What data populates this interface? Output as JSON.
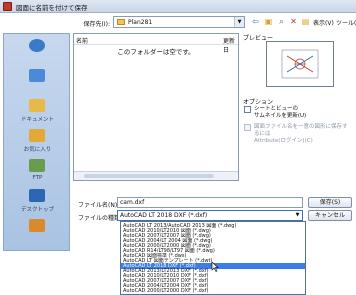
{
  "window": {
    "title": "図面に名前を付けて保存"
  },
  "toolbar": {
    "save_in_label": "保存先(I):",
    "save_in_value": "Plan281",
    "view_label": "表示(V)",
    "tools_label": "ツール(L)"
  },
  "places": [
    {
      "label": "",
      "icon": "history-icon",
      "color": "#3a7bc8"
    },
    {
      "label": "",
      "icon": "network-icon",
      "color": "#4a8ad8"
    },
    {
      "label": "ドキュメント",
      "icon": "documents-icon",
      "color": "#e8b84a"
    },
    {
      "label": "お気に入り",
      "icon": "favorites-icon",
      "color": "#e3a936"
    },
    {
      "label": "FTP",
      "icon": "ftp-icon",
      "color": "#6a9c4e"
    },
    {
      "label": "デスクトップ",
      "icon": "desktop-icon",
      "color": "#2f66b3"
    },
    {
      "label": "",
      "icon": "buzzsaw-icon",
      "color": "#d98b2b"
    }
  ],
  "file_list": {
    "col_name": "名前",
    "col_date": "更新日",
    "empty_message": "このフォルダーは空です。"
  },
  "preview": {
    "label": "プレビュー"
  },
  "options": {
    "label": "オプション",
    "check1": "シートとビューの\nサムネイルを更新(U)",
    "check2": "図面ファイル名を一意の図形に保存するには\nAttribute(ログイン)(C)"
  },
  "form": {
    "filename_label": "ファイル名(N):",
    "filename_value": "cam.dxf",
    "filetype_label": "ファイルの種類(T):",
    "filetype_value": "AutoCAD LT 2018 DXF (*.dxf)"
  },
  "buttons": {
    "save": "保存(S)",
    "cancel": "キャンセル"
  },
  "dropdown": {
    "items": [
      "AutoCAD LT 2013/AutoCAD 2013 図面 (*.dwg)",
      "AutoCAD 2010/LT2010 図面 (*.dwg)",
      "AutoCAD 2007/LT2007 図面 (*.dwg)",
      "AutoCAD 2004/LT 2004 図面 (*.dwg)",
      "AutoCAD 2000/LT2000 図面 (*.dwg)",
      "AutoCAD R14/LT98/LT97 図面 (*.dwg)",
      "AutoCAD 図面標準 (*.dws)",
      "AutoCAD LT 図面テンプレート (*.dwt)",
      "AutoCAD LT 2018 DXF (*.dxf)",
      "AutoCAD 2013/LT2013 DXF (*.dxf)",
      "AutoCAD 2010/LT2010 DXF (*.dxf)",
      "AutoCAD 2007/LT2007 DXF (*.dxf)",
      "AutoCAD 2004/LT2004 DXF (*.dxf)",
      "AutoCAD 2000/LT2000 DXF (*.dxf)",
      "AutoCAD R12/LT2 DXF (*.dxf)"
    ],
    "selected_index": 8
  }
}
